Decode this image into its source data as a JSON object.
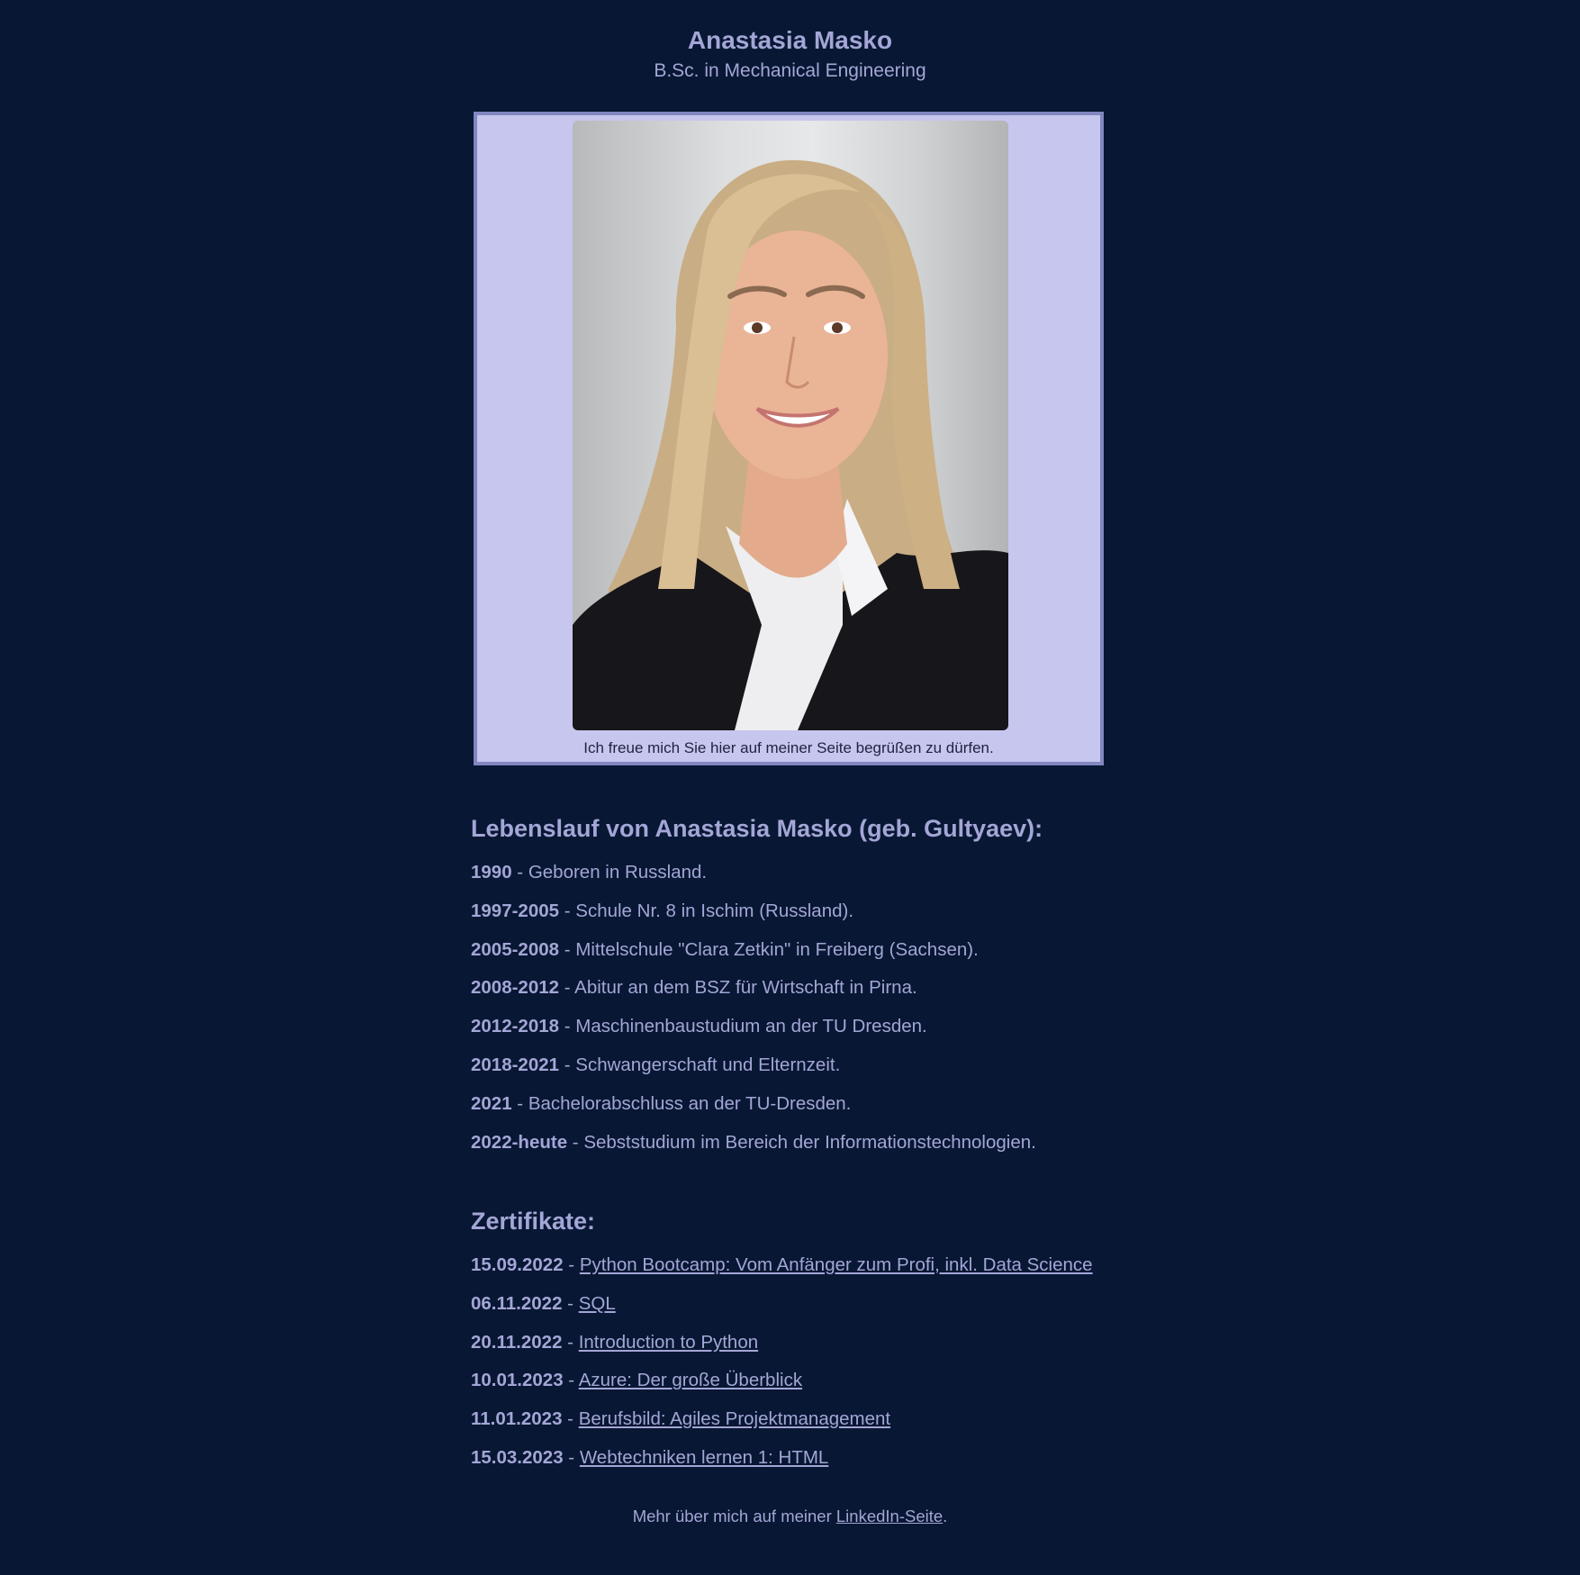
{
  "header": {
    "name": "Anastasia Masko",
    "degree": "B.Sc. in Mechanical Engineering"
  },
  "photo": {
    "caption": "Ich freue mich Sie hier auf meiner Seite begrüßen zu dürfen."
  },
  "cv": {
    "title": "Lebenslauf von Anastasia Masko (geb. Gultyaev):",
    "items": [
      {
        "year": "1990",
        "separator": " - ",
        "text": "Geboren in Russland."
      },
      {
        "year": "1997-2005",
        "separator": " - ",
        "text": "Schule Nr. 8 in Ischim (Russland)."
      },
      {
        "year": "2005-2008",
        "separator": " - ",
        "text": "Mittelschule \"Clara Zetkin\" in Freiberg (Sachsen)."
      },
      {
        "year": "2008-2012",
        "separator": " - ",
        "text": "Abitur an dem BSZ für Wirtschaft in Pirna."
      },
      {
        "year": "2012-2018",
        "separator": " - ",
        "text": "Maschinenbaustudium an der TU Dresden."
      },
      {
        "year": "2018-2021",
        "separator": " - ",
        "text": "Schwangerschaft und Elternzeit."
      },
      {
        "year": "2021",
        "separator": " - ",
        "text": "Bachelorabschluss an der TU-Dresden."
      },
      {
        "year": "2022-heute",
        "separator": " - ",
        "text": "Sebststudium im Bereich der Informationstechnologien."
      }
    ]
  },
  "certificates": {
    "title": "Zertifikate:",
    "items": [
      {
        "date": "15.09.2022",
        "separator": " - ",
        "link": "Python Bootcamp: Vom Anfänger zum Profi, inkl. Data Science"
      },
      {
        "date": "06.11.2022",
        "separator": " - ",
        "link": "SQL"
      },
      {
        "date": "20.11.2022",
        "separator": " - ",
        "link": "Introduction to Python"
      },
      {
        "date": "10.01.2023",
        "separator": " - ",
        "link": "Azure: Der große Überblick"
      },
      {
        "date": "11.01.2023",
        "separator": " - ",
        "link": "Berufsbild: Agiles Projektmanagement"
      },
      {
        "date": "15.03.2023",
        "separator": " - ",
        "link": "Webtechniken lernen 1: HTML"
      }
    ]
  },
  "footer": {
    "text_before": "Mehr über mich auf meiner ",
    "link": "LinkedIn-Seite",
    "text_after": "."
  },
  "colors": {
    "background": "#081733",
    "text": "#a3a6d6",
    "frame": "#c6c6ee",
    "frame_border": "#8187c0"
  }
}
